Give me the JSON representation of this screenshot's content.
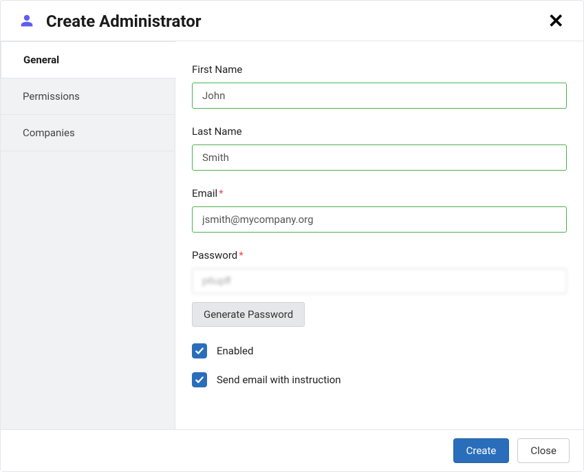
{
  "header": {
    "title": "Create Administrator"
  },
  "tabs": [
    {
      "label": "General",
      "active": true
    },
    {
      "label": "Permissions",
      "active": false
    },
    {
      "label": "Companies",
      "active": false
    }
  ],
  "form": {
    "firstName": {
      "label": "First Name",
      "value": "John"
    },
    "lastName": {
      "label": "Last Name",
      "value": "Smith"
    },
    "email": {
      "label": "Email",
      "value": "jsmith@mycompany.org",
      "required": true
    },
    "password": {
      "label": "Password",
      "value": "p6upff",
      "required": true
    },
    "generatePasswordLabel": "Generate Password",
    "enabled": {
      "label": "Enabled",
      "checked": true
    },
    "sendEmail": {
      "label": "Send email with instruction",
      "checked": true
    }
  },
  "footer": {
    "createLabel": "Create",
    "closeLabel": "Close"
  }
}
